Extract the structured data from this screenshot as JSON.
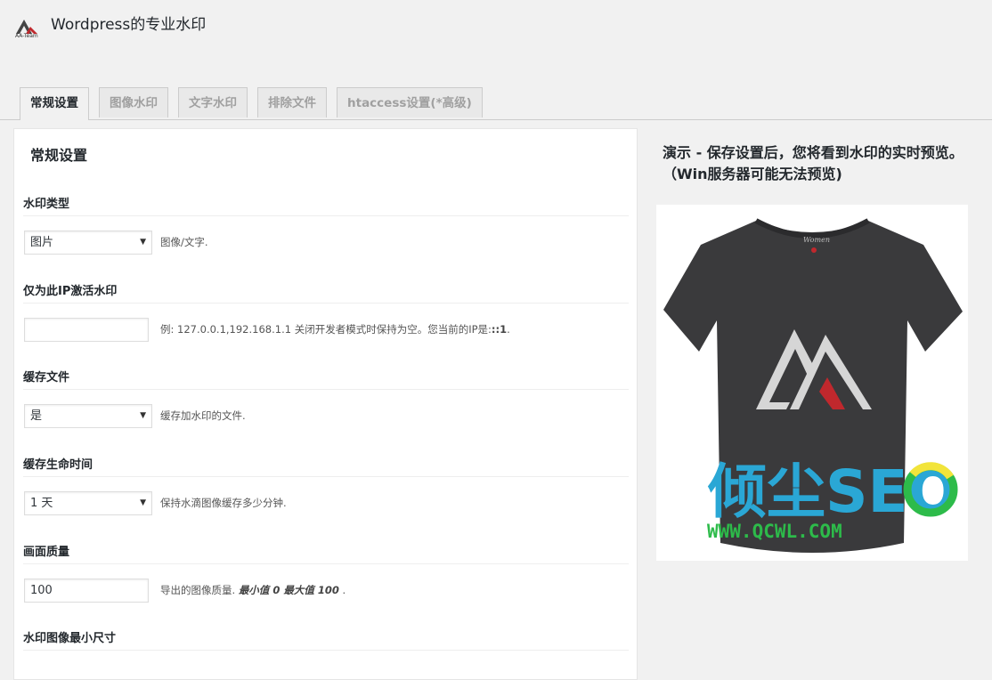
{
  "header": {
    "logo_text": "AA-Team",
    "title": "Wordpress的专业水印"
  },
  "tabs": [
    {
      "label": "常规设置",
      "active": true
    },
    {
      "label": "图像水印",
      "active": false
    },
    {
      "label": "文字水印",
      "active": false
    },
    {
      "label": "排除文件",
      "active": false
    },
    {
      "label": "htaccess设置(*高级)",
      "active": false
    }
  ],
  "panel": {
    "title": "常规设置",
    "fields": {
      "watermark_type": {
        "label": "水印类型",
        "value": "图片",
        "description": "图像/文字."
      },
      "ip_only": {
        "label": "仅为此IP激活水印",
        "value": "",
        "description": "例: 127.0.0.1,192.168.1.1 关闭开发者模式时保持为空。您当前的IP是:",
        "current_ip": "::1",
        "description_end": "."
      },
      "cache_files": {
        "label": "缓存文件",
        "value": "是",
        "description": "缓存加水印的文件."
      },
      "cache_lifetime": {
        "label": "缓存生命时间",
        "value": "1 天",
        "description": "保持水滴图像缓存多少分钟."
      },
      "quality": {
        "label": "画面质量",
        "value": "100",
        "description_prefix": "导出的图像质量. ",
        "description_bold": "最小值 0 最大值 100",
        "description_suffix": " ."
      },
      "min_size": {
        "label": "水印图像最小尺寸"
      }
    }
  },
  "preview": {
    "title": "演示 - 保存设置后，您将看到水印的实时预览。（Win服务器可能无法预览)",
    "image_watermark_text": "倾尘SEO",
    "image_watermark_url": "WWW.QCWL.COM",
    "shirt_label": "Women",
    "colors": {
      "shirt": "#3a3a3c",
      "logo_gray": "#d6d6d6",
      "logo_red": "#c0282d",
      "watermark_blue": "#2aa7d5",
      "watermark_green": "#2dbb4a",
      "watermark_yellow": "#f2e43a"
    }
  }
}
